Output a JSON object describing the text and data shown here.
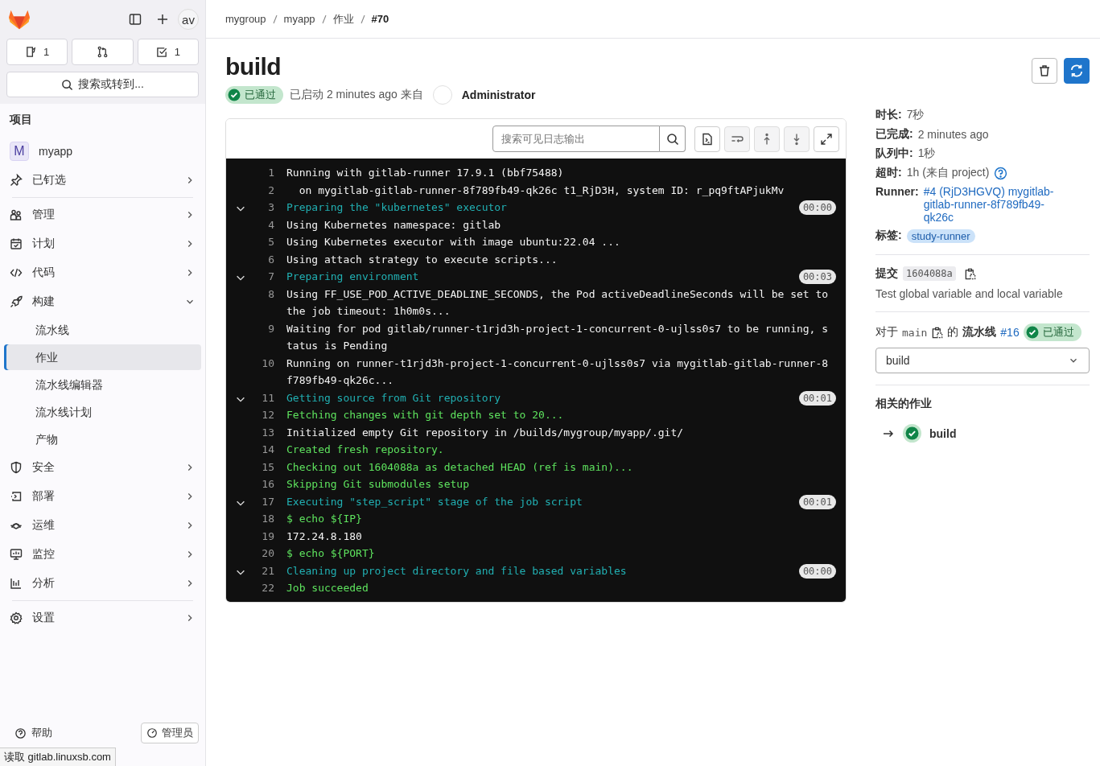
{
  "sidebar": {
    "avatar": "av",
    "counters": [
      {
        "kind": "issues",
        "count": "1"
      },
      {
        "kind": "merge-requests"
      },
      {
        "kind": "todos",
        "count": "1"
      }
    ],
    "search": {
      "label": "搜索或转到..."
    },
    "heading": "项目",
    "project": {
      "initial": "M",
      "name": "myapp"
    },
    "pinned": {
      "label": "已钉选",
      "expanded": false
    },
    "items": [
      {
        "kind": "manage",
        "label": "管理",
        "expanded": false
      },
      {
        "kind": "plan",
        "label": "计划",
        "expanded": false
      },
      {
        "kind": "code",
        "label": "代码",
        "expanded": false
      },
      {
        "kind": "build",
        "label": "构建",
        "expanded": true,
        "children": [
          {
            "label": "流水线",
            "selected": false
          },
          {
            "label": "作业",
            "selected": true
          },
          {
            "label": "流水线编辑器",
            "selected": false
          },
          {
            "label": "流水线计划",
            "selected": false
          },
          {
            "label": "产物",
            "selected": false
          }
        ]
      },
      {
        "kind": "secure",
        "label": "安全",
        "expanded": false
      },
      {
        "kind": "deploy",
        "label": "部署",
        "expanded": false
      },
      {
        "kind": "operate",
        "label": "运维",
        "expanded": false
      },
      {
        "kind": "monitor",
        "label": "监控",
        "expanded": false
      },
      {
        "kind": "analyze",
        "label": "分析",
        "expanded": false
      }
    ],
    "settings": {
      "label": "设置",
      "expanded": false
    },
    "help": "帮助",
    "admin": "管理员"
  },
  "breadcrumb": [
    "mygroup",
    "myapp",
    "作业",
    "#70"
  ],
  "job": {
    "title": "build",
    "status": "已通过",
    "started": "已启动 2 minutes ago 来自",
    "user": "Administrator"
  },
  "log": {
    "search_placeholder": "搜索可见日志输出",
    "lines": [
      {
        "n": "1",
        "kind": "plain",
        "text": "Running with gitlab-runner 17.9.1 (bbf75488)"
      },
      {
        "n": "2",
        "kind": "plain",
        "text": "  on mygitlab-gitlab-runner-8f789fb49-qk26c t1_RjD3H, system ID: r_pq9ftAPjukMv"
      },
      {
        "n": "3",
        "kind": "section",
        "expanded": true,
        "duration": "00:00",
        "text": "Preparing the \"kubernetes\" executor"
      },
      {
        "n": "4",
        "kind": "plain",
        "text": "Using Kubernetes namespace: gitlab"
      },
      {
        "n": "5",
        "kind": "plain",
        "text": "Using Kubernetes executor with image ubuntu:22.04 ..."
      },
      {
        "n": "6",
        "kind": "plain",
        "text": "Using attach strategy to execute scripts..."
      },
      {
        "n": "7",
        "kind": "section",
        "expanded": true,
        "duration": "00:03",
        "text": "Preparing environment"
      },
      {
        "n": "8",
        "kind": "plain",
        "text": "Using FF_USE_POD_ACTIVE_DEADLINE_SECONDS, the Pod activeDeadlineSeconds will be set to the job timeout: 1h0m0s..."
      },
      {
        "n": "9",
        "kind": "plain",
        "text": "Waiting for pod gitlab/runner-t1rjd3h-project-1-concurrent-0-ujlss0s7 to be running, status is Pending"
      },
      {
        "n": "10",
        "kind": "plain",
        "text": "Running on runner-t1rjd3h-project-1-concurrent-0-ujlss0s7 via mygitlab-gitlab-runner-8f789fb49-qk26c..."
      },
      {
        "n": "11",
        "kind": "section",
        "expanded": true,
        "duration": "00:01",
        "text": "Getting source from Git repository"
      },
      {
        "n": "12",
        "kind": "success",
        "text": "Fetching changes with git depth set to 20..."
      },
      {
        "n": "13",
        "kind": "plain",
        "text": "Initialized empty Git repository in /builds/mygroup/myapp/.git/"
      },
      {
        "n": "14",
        "kind": "success",
        "text": "Created fresh repository."
      },
      {
        "n": "15",
        "kind": "success",
        "text": "Checking out 1604088a as detached HEAD (ref is main)..."
      },
      {
        "n": "16",
        "kind": "success",
        "text": "Skipping Git submodules setup"
      },
      {
        "n": "17",
        "kind": "section",
        "expanded": true,
        "duration": "00:01",
        "text": "Executing \"step_script\" stage of the job script"
      },
      {
        "n": "18",
        "kind": "success",
        "text": "$ echo ${IP}"
      },
      {
        "n": "19",
        "kind": "plain",
        "text": "172.24.8.180"
      },
      {
        "n": "20",
        "kind": "success",
        "text": "$ echo ${PORT}"
      },
      {
        "n": "21",
        "kind": "section",
        "expanded": true,
        "duration": "00:00",
        "text": "Cleaning up project directory and file based variables"
      },
      {
        "n": "22",
        "kind": "success",
        "text": "Job succeeded"
      }
    ]
  },
  "details": {
    "rows": [
      {
        "label": "时长:",
        "value": "7秒"
      },
      {
        "label": "已完成:",
        "value": "2 minutes ago"
      },
      {
        "label": "队列中:",
        "value": "1秒"
      },
      {
        "label": "超时:",
        "value": "1h (来自 project)",
        "help": true
      }
    ],
    "runner": {
      "label": "Runner:",
      "value": "#4 (RjD3HGVQ) mygitlab-gitlab-runner-8f789fb49-qk26c"
    },
    "tags": {
      "label": "标签:",
      "items": [
        "study-runner"
      ]
    },
    "commit": {
      "label": "提交",
      "sha": "1604088a",
      "message": "Test global variable and local variable"
    },
    "pipeline": {
      "prefix": "对于",
      "branch": "main",
      "of": "的",
      "label": "流水线",
      "id": "#16",
      "status": "已通过"
    },
    "job_select": "build",
    "related": {
      "heading": "相关的作业",
      "jobs": [
        {
          "name": "build",
          "current": true
        }
      ]
    }
  },
  "status_bar": "读取 gitlab.linuxsb.com"
}
